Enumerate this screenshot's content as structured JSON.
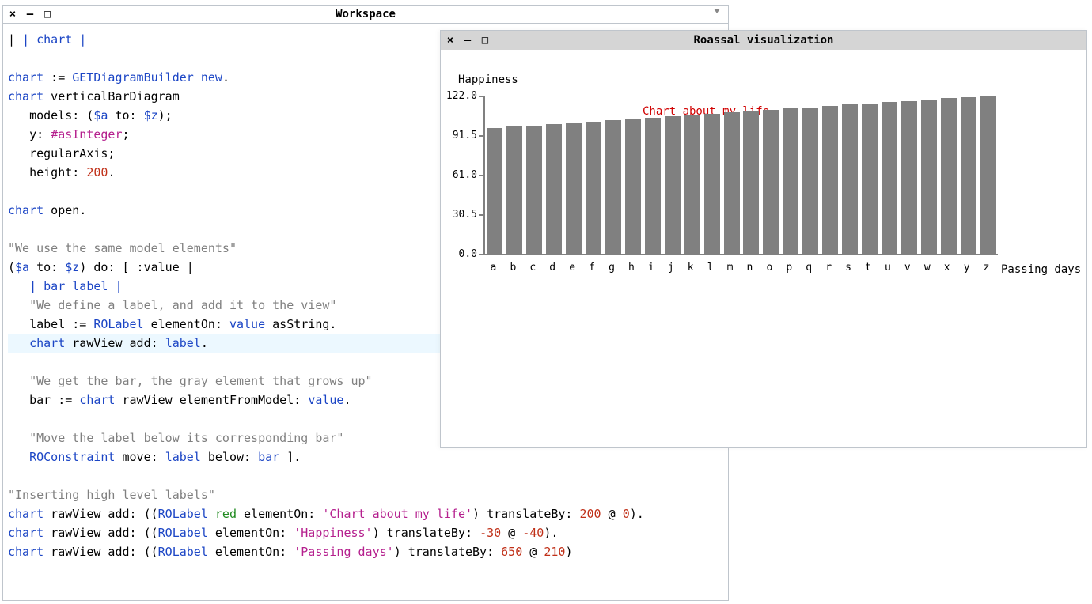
{
  "workspace": {
    "title": "Workspace",
    "code": {
      "l1": "| chart |",
      "l2_a": "chart",
      "l2_b": " := ",
      "l2_c": "GETDiagramBuilder new",
      "l3_a": "chart",
      "l3_b": " verticalBarDiagram",
      "l4_a": "   models: (",
      "l4_b": "$a",
      "l4_c": " to: ",
      "l4_d": "$z",
      "l4_e": ");",
      "l5_a": "   y: ",
      "l5_b": "#asInteger",
      "l5_c": ";",
      "l6": "   regularAxis;",
      "l7_a": "   height: ",
      "l7_b": "200",
      "l8_a": "chart",
      "l8_b": " open.",
      "c1": "\"We use the same model elements\"",
      "l9_a": "(",
      "l9_b": "$a",
      "l9_c": " to: ",
      "l9_d": "$z",
      "l9_e": ") do: [ :value |",
      "l10": "   | bar label |",
      "c2": "   \"We define a label, and add it to the view\"",
      "l11_a": "   label := ",
      "l11_b": "ROLabel",
      "l11_c": " elementOn: ",
      "l11_d": "value",
      "l11_e": " asString.",
      "l12_a": "   chart",
      "l12_b": " rawView add: ",
      "l12_c": "label",
      "c3": "   \"We get the bar, the gray element that grows up\"",
      "l13_a": "   bar := ",
      "l13_b": "chart",
      "l13_c": " rawView elementFromModel: ",
      "l13_d": "value",
      "c4": "   \"Move the label below its corresponding bar\"",
      "l14_a": "   ROConstraint",
      "l14_b": " move: ",
      "l14_c": "label",
      "l14_d": " below: ",
      "l14_e": "bar",
      "l14_f": " ].",
      "c5": "\"Inserting high level labels\"",
      "l15_a": "chart",
      "l15_b": " rawView add: ((",
      "l15_c": "ROLabel",
      "l15_d": " red",
      "l15_e": " elementOn: ",
      "l15_f": "'Chart about my life'",
      "l15_g": ") translateBy: ",
      "l15_h": "200",
      "l15_i": " @ ",
      "l15_j": "0",
      "l15_k": ").",
      "l16_a": "chart",
      "l16_b": " rawView add: ((",
      "l16_c": "ROLabel",
      "l16_d": " elementOn: ",
      "l16_e": "'Happiness'",
      "l16_f": ") translateBy: ",
      "l16_g": "-30",
      "l16_h": " @ ",
      "l16_i": "-40",
      "l16_j": ").",
      "l17_a": "chart",
      "l17_b": " rawView add: ((",
      "l17_c": "ROLabel",
      "l17_d": " elementOn: ",
      "l17_e": "'Passing days'",
      "l17_f": ") translateBy: ",
      "l17_g": "650",
      "l17_h": " @ ",
      "l17_i": "210",
      "l17_j": ")"
    }
  },
  "viz": {
    "title": "Roassal visualization"
  },
  "chart_data": {
    "type": "bar",
    "title": "Chart about my life",
    "xlabel": "Passing days",
    "ylabel": "Happiness",
    "ylim": [
      0,
      122
    ],
    "yticks": [
      0.0,
      30.5,
      61.0,
      91.5,
      122.0
    ],
    "categories": [
      "a",
      "b",
      "c",
      "d",
      "e",
      "f",
      "g",
      "h",
      "i",
      "j",
      "k",
      "l",
      "m",
      "n",
      "o",
      "p",
      "q",
      "r",
      "s",
      "t",
      "u",
      "v",
      "w",
      "x",
      "y",
      "z"
    ],
    "values": [
      97,
      98,
      99,
      100,
      101,
      102,
      103,
      104,
      105,
      106,
      107,
      108,
      109,
      110,
      111,
      112,
      113,
      114,
      115,
      116,
      117,
      118,
      119,
      120,
      121,
      122
    ]
  }
}
